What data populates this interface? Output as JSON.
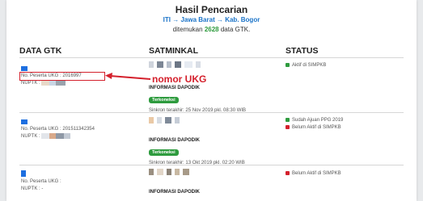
{
  "header": {
    "title": "Hasil Pencarian",
    "crumb_1": "ITI",
    "crumb_2": "Jawa Barat",
    "crumb_3": "Kab. Bogor",
    "crumb_sep": "→",
    "found_prefix": "ditemukan",
    "found_count": "2628",
    "found_suffix": "data GTK."
  },
  "columns": {
    "gtk": "DATA GTK",
    "satminkal": "SATMINKAL",
    "status": "STATUS"
  },
  "annotation": {
    "label": "nomor UKG"
  },
  "rows": [
    {
      "ukg": "No. Peserta UKG : 2016997",
      "nuptk": "NUPTK :",
      "info": "INFORMASI DAPODIK",
      "badge": "Terkoneksi",
      "sync": "Sinkron terakhir: 25 Nov 2019 pkl. 08:30 WIB",
      "status": [
        "Aktif di SIMPKB"
      ]
    },
    {
      "ukg": "No. Peserta UKG : 201511342354",
      "nuptk": "NUPTK :",
      "info": "INFORMASI DAPODIK",
      "badge": "Terkoneksi",
      "sync": "Sinkron terakhir: 13 Okt 2019 pkl. 02:20 WIB",
      "status": [
        "Sudah Ajuan PPG 2019",
        "Belum Aktif di SIMPKB"
      ]
    },
    {
      "ukg": "No. Peserta UKG :",
      "nuptk": "NUPTK : -",
      "info": "INFORMASI DAPODIK",
      "status": [
        "Belum Aktif di SIMPKB"
      ]
    }
  ],
  "colors": {
    "accent": "#1a73c8",
    "success": "#2e9b3e",
    "danger": "#d4202c"
  }
}
